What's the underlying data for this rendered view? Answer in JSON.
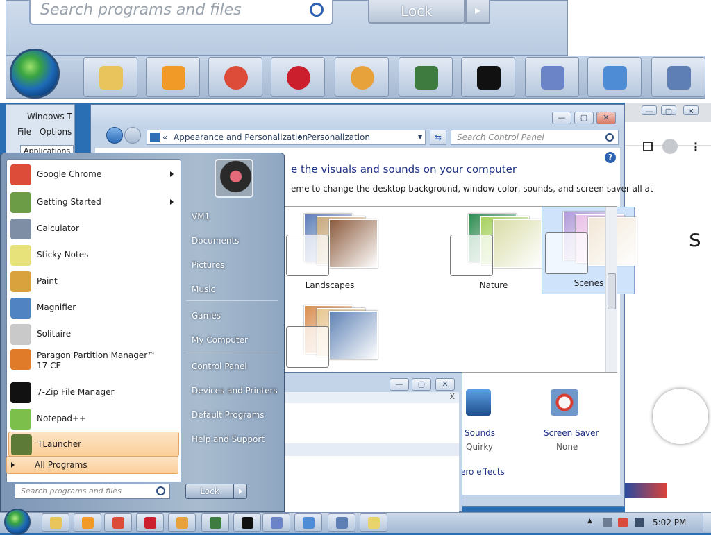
{
  "zoom": {
    "search_placeholder": "Search programs and files",
    "lock_label": "Lock"
  },
  "task_manager": {
    "title": "Windows T",
    "menu_file": "File",
    "menu_options": "Options",
    "tab_applications": "Applications"
  },
  "control_panel": {
    "breadcrumb_root": "«",
    "breadcrumb_1": "Appearance and Personalization",
    "breadcrumb_sep": "▸",
    "breadcrumb_2": "Personalization",
    "search_placeholder": "Search Control Panel",
    "heading": "e the visuals and sounds on your computer",
    "subtext": "eme to change the desktop background, window color, sounds, and screen saver all at",
    "themes": [
      {
        "name": "Landscapes",
        "colors": [
          "#5d7db8",
          "#c7a87a",
          "#8c5a3c"
        ]
      },
      {
        "name": "Nature",
        "colors": [
          "#2e8a4f",
          "#a4d15c",
          "#d9dca7"
        ]
      },
      {
        "name": "Scenes",
        "colors": [
          "#b09ad8",
          "#e9c0e8",
          "#f2e7d6"
        ]
      },
      {
        "name": "",
        "colors": [
          "#d98d4f",
          "#e8c690",
          "#5f82b5"
        ]
      }
    ],
    "sounds_label": "Sounds",
    "sounds_value": "Quirky",
    "screensaver_label": "Screen Saver",
    "screensaver_value": "None",
    "aero_link": "ero effects"
  },
  "start_menu": {
    "programs": [
      {
        "label": "Google Chrome",
        "icon": "chrome-icon",
        "arrow": true,
        "color": "#dd4b39"
      },
      {
        "label": "Getting Started",
        "icon": "getting-started-icon",
        "arrow": true,
        "color": "#6d9c47"
      },
      {
        "label": "Calculator",
        "icon": "calculator-icon",
        "arrow": false,
        "color": "#7e8fa5"
      },
      {
        "label": "Sticky Notes",
        "icon": "sticky-notes-icon",
        "arrow": false,
        "color": "#e8e27a"
      },
      {
        "label": "Paint",
        "icon": "paint-icon",
        "arrow": false,
        "color": "#d9a23c"
      },
      {
        "label": "Magnifier",
        "icon": "magnifier-icon",
        "arrow": false,
        "color": "#4f83c2"
      },
      {
        "label": "Solitaire",
        "icon": "solitaire-icon",
        "arrow": false,
        "color": "#c9c9c9"
      },
      {
        "label": "Paragon Partition Manager™ 17 CE",
        "icon": "paragon-icon",
        "arrow": false,
        "color": "#e07b2a"
      },
      {
        "label": "7-Zip File Manager",
        "icon": "seven-zip-icon",
        "arrow": false,
        "color": "#111111"
      },
      {
        "label": "Notepad++",
        "icon": "notepad-plus-plus-icon",
        "arrow": false,
        "color": "#7cbf4a"
      },
      {
        "label": "TLauncher",
        "icon": "tlauncher-icon",
        "arrow": false,
        "color": "#5d7a36",
        "highlighted": true
      }
    ],
    "all_programs": "All Programs",
    "search_placeholder": "Search programs and files",
    "user_items": [
      {
        "label": "VM1"
      },
      {
        "label": "Documents"
      },
      {
        "label": "Pictures"
      },
      {
        "label": "Music"
      },
      {
        "label": "Games"
      },
      {
        "label": "My Computer"
      },
      {
        "label": "Control Panel"
      },
      {
        "label": "Devices and Printers"
      },
      {
        "label": "Default Programs"
      },
      {
        "label": "Help and Support"
      }
    ],
    "lock_label": "Lock"
  },
  "taskbar": {
    "apps": [
      {
        "name": "explorer-icon",
        "color": "#e9c35c"
      },
      {
        "name": "media-player-icon",
        "color": "#f29a28"
      },
      {
        "name": "chrome-icon",
        "color": "#dd4b39"
      },
      {
        "name": "opera-icon",
        "color": "#cc1f2d"
      },
      {
        "name": "firefox-icon",
        "color": "#e8a23b"
      },
      {
        "name": "task-manager-icon",
        "color": "#3d7b3f"
      },
      {
        "name": "seven-zip-icon",
        "color": "#111111"
      },
      {
        "name": "appearance-icon",
        "color": "#6b84c7"
      },
      {
        "name": "control-panel-icon",
        "color": "#4f8cd6"
      },
      {
        "name": "remote-desktop-icon",
        "color": "#5d7fb6"
      },
      {
        "name": "notepad-icon",
        "color": "#e8d46b"
      }
    ],
    "clock": "5:02 PM"
  }
}
